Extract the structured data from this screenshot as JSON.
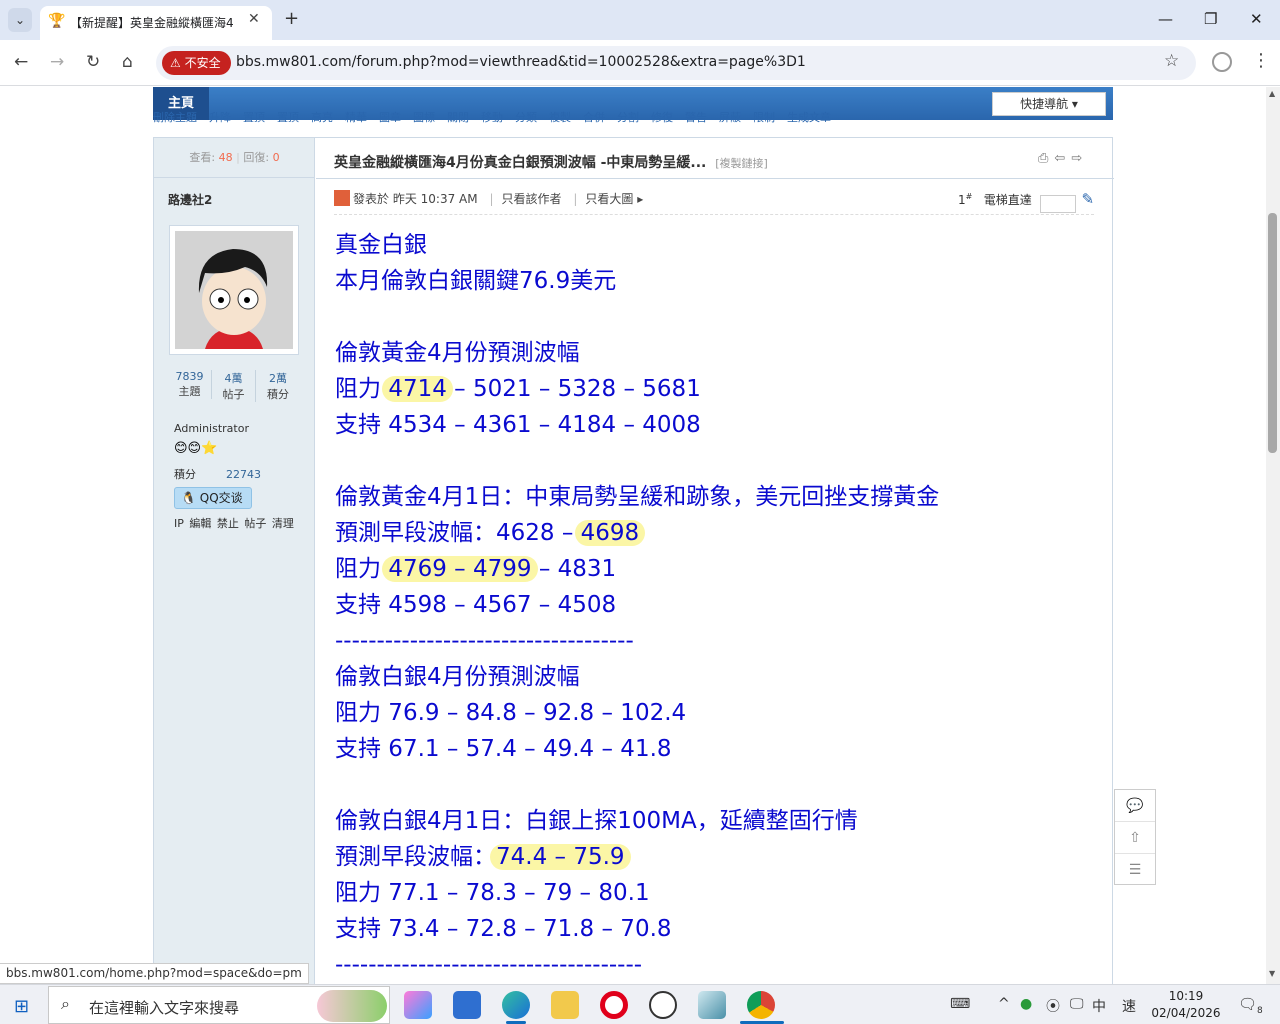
{
  "browser": {
    "tab_title": "【新提醒】英皇金融縱橫匯海4",
    "tab_favicon": "trophy-icon",
    "insecure_label": "不安全",
    "url": "bbs.mw801.com/forum.php?mod=viewthread&tid=10002528&extra=page%3D1"
  },
  "forum": {
    "nav_home": "主頁",
    "nav_items": [
      "刪除主題",
      "升降",
      "置頂",
      "置頂",
      "高亮",
      "精華",
      "圖章",
      "圖標",
      "關閉",
      "移動",
      "分類",
      "複製",
      "合併",
      "分割",
      "修復",
      "警告",
      "屏蔽",
      "限制",
      "生成文章"
    ],
    "quick_nav": "快捷導航 ▾",
    "stats": {
      "views_label": "查看:",
      "views": "48",
      "replies_label": "回復:",
      "replies": "0"
    },
    "author": "路邊社2",
    "counts": [
      {
        "value": "7839",
        "label": "主題"
      },
      {
        "value": "4萬",
        "label": "帖子"
      },
      {
        "value": "2萬",
        "label": "積分"
      }
    ],
    "rank": "Administrator",
    "medals": "😊😊⭐",
    "score_label": "積分",
    "score_value": "22743",
    "qq_label": "QQ交谈",
    "admin_links": "IP 編輯 禁止 帖子 清理"
  },
  "thread": {
    "title": "英皇金融縱橫匯海4月份真金白銀預測波幅 -中東局勢呈緩...",
    "copy_link": "[複製鏈接]",
    "posted_prefix": "發表於",
    "posted_time": "昨天 10:37 AM",
    "only_author": "只看該作者",
    "only_big": "只看大圖",
    "floor": "1",
    "floor_sup": "#",
    "elevator": "電梯直達"
  },
  "post_lines": [
    {
      "text": "真金白銀"
    },
    {
      "text": "本月倫敦白銀關鍵76.9美元"
    },
    {
      "gap": true
    },
    {
      "text": "倫敦黃金4月份預測波幅"
    },
    {
      "parts": [
        {
          "t": "阻力 "
        },
        {
          "t": "4714",
          "hl": true
        },
        {
          "t": " – 5021 – 5328 – 5681"
        }
      ]
    },
    {
      "text": "支持 4534 – 4361 – 4184 – 4008"
    },
    {
      "gap": true
    },
    {
      "text": "倫敦黃金4月1日：中東局勢呈緩和跡象，美元回挫支撐黃金"
    },
    {
      "parts": [
        {
          "t": "預測早段波幅：4628 – "
        },
        {
          "t": "4698",
          "hl": true
        }
      ]
    },
    {
      "parts": [
        {
          "t": "阻力 "
        },
        {
          "t": "4769 – 4799",
          "hl": true
        },
        {
          "t": " – 4831"
        }
      ]
    },
    {
      "text": "支持 4598 – 4567 – 4508"
    },
    {
      "text": "------------------------------------"
    },
    {
      "text": "倫敦白銀4月份預測波幅"
    },
    {
      "text": "阻力 76.9 – 84.8 – 92.8 – 102.4"
    },
    {
      "text": "支持 67.1 – 57.4 – 49.4 – 41.8"
    },
    {
      "gap": true
    },
    {
      "text": "倫敦白銀4月1日：白銀上探100MA，延續整固行情"
    },
    {
      "parts": [
        {
          "t": "預測早段波幅："
        },
        {
          "t": "74.4 – 75.9",
          "hl": true
        }
      ]
    },
    {
      "text": "阻力 77.1 – 78.3 – 79 – 80.1"
    },
    {
      "text": "支持 73.4 – 72.8 – 71.8 – 70.8"
    },
    {
      "text": "-------------------------------------"
    }
  ],
  "status_url": "bbs.mw801.com/home.php?mod=space&do=pm",
  "taskbar": {
    "search_placeholder": "在這裡輸入文字來搜尋",
    "ime": "中",
    "speed": "速",
    "time": "10:19",
    "date": "02/04/2026",
    "notif_count": "8"
  },
  "colors": {
    "post_text": "#0a0acf",
    "highlight": "#fbf6a6",
    "nav_blue": "#2a66ad",
    "insecure": "#c5221f"
  }
}
